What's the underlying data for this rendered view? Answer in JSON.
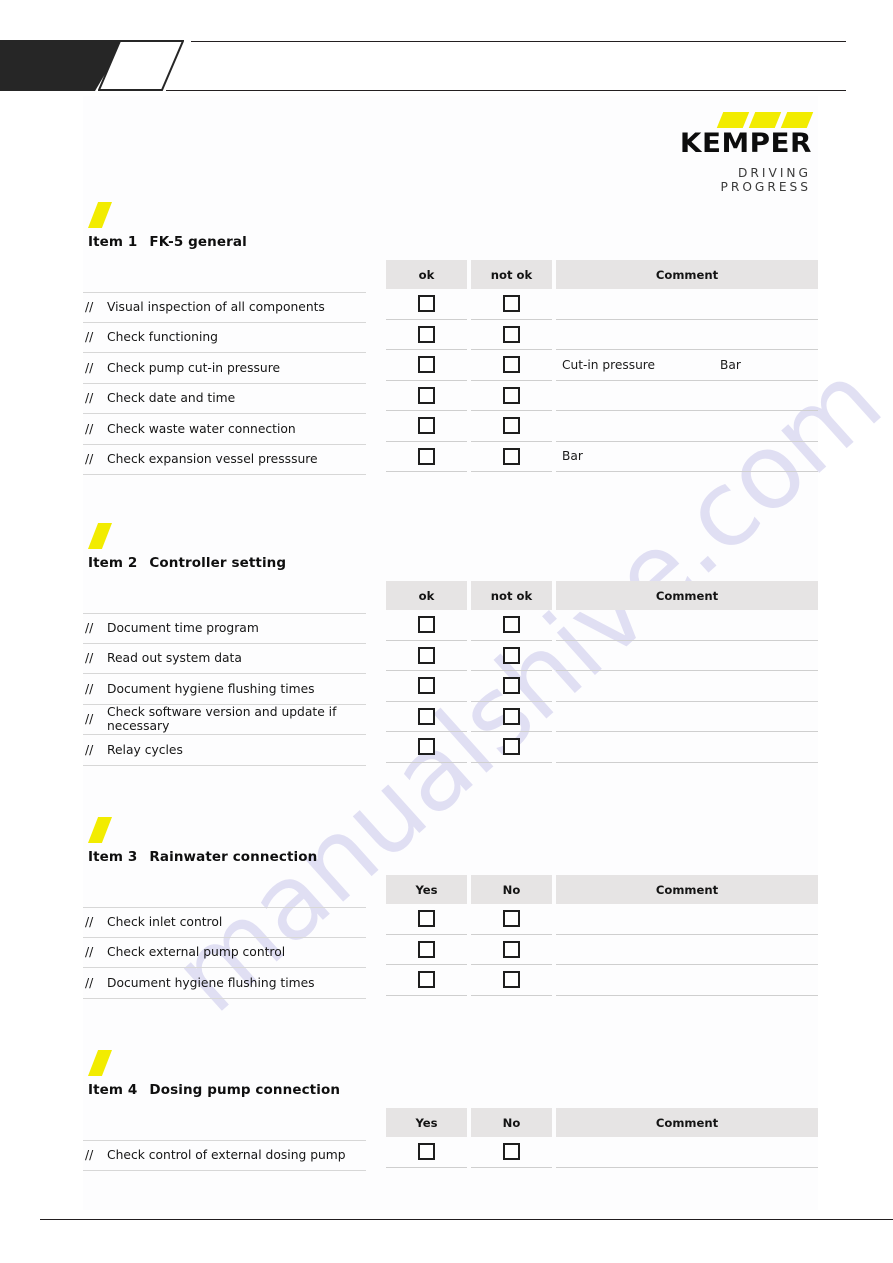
{
  "brand": {
    "name": "KEMPER",
    "tagline": "DRIVING PROGRESS",
    "accent_yellow": "#f2ec00",
    "bar_count": 3
  },
  "watermark": {
    "text": "manualshive.com",
    "color": "#b9b6e4"
  },
  "header": {
    "dark_shape": "parallelogram",
    "outline_shape": "parallelogram-outline",
    "rule_color": "#231f20"
  },
  "sections": [
    {
      "number": "Item 1",
      "title": "FK-5 general",
      "columns": {
        "a": "ok",
        "b": "not ok",
        "c": "Comment"
      },
      "rows": [
        {
          "bullet": "//",
          "label": "Visual inspection of all components",
          "comment": "",
          "unit": ""
        },
        {
          "bullet": "//",
          "label": "Check functioning",
          "comment": "",
          "unit": ""
        },
        {
          "bullet": "//",
          "label": "Check pump cut-in pressure",
          "comment": "Cut-in pressure",
          "unit": "Bar"
        },
        {
          "bullet": "//",
          "label": "Check date and time",
          "comment": "",
          "unit": ""
        },
        {
          "bullet": "//",
          "label": "Check waste water connection",
          "comment": "",
          "unit": ""
        },
        {
          "bullet": "//",
          "label": "Check expansion vessel presssure",
          "comment": "Bar",
          "unit": ""
        }
      ]
    },
    {
      "number": "Item 2",
      "title": "Controller setting",
      "columns": {
        "a": "ok",
        "b": "not ok",
        "c": "Comment"
      },
      "rows": [
        {
          "bullet": "//",
          "label": "Document time program",
          "comment": "",
          "unit": ""
        },
        {
          "bullet": "//",
          "label": "Read out system data",
          "comment": "",
          "unit": ""
        },
        {
          "bullet": "//",
          "label": "Document hygiene flushing times",
          "comment": "",
          "unit": ""
        },
        {
          "bullet": "//",
          "label": "Check software version and update if necessary",
          "comment": "",
          "unit": ""
        },
        {
          "bullet": "//",
          "label": "Relay cycles",
          "comment": "",
          "unit": ""
        }
      ]
    },
    {
      "number": "Item 3",
      "title": "Rainwater connection",
      "columns": {
        "a": "Yes",
        "b": "No",
        "c": "Comment"
      },
      "rows": [
        {
          "bullet": "//",
          "label": "Check inlet control",
          "comment": "",
          "unit": ""
        },
        {
          "bullet": "//",
          "label": "Check external pump control",
          "comment": "",
          "unit": ""
        },
        {
          "bullet": "//",
          "label": "Document hygiene flushing times",
          "comment": "",
          "unit": ""
        }
      ]
    },
    {
      "number": "Item 4",
      "title": "Dosing pump connection",
      "columns": {
        "a": "Yes",
        "b": "No",
        "c": "Comment"
      },
      "rows": [
        {
          "bullet": "//",
          "label": "Check control of external dosing pump",
          "comment": "",
          "unit": ""
        }
      ]
    }
  ]
}
